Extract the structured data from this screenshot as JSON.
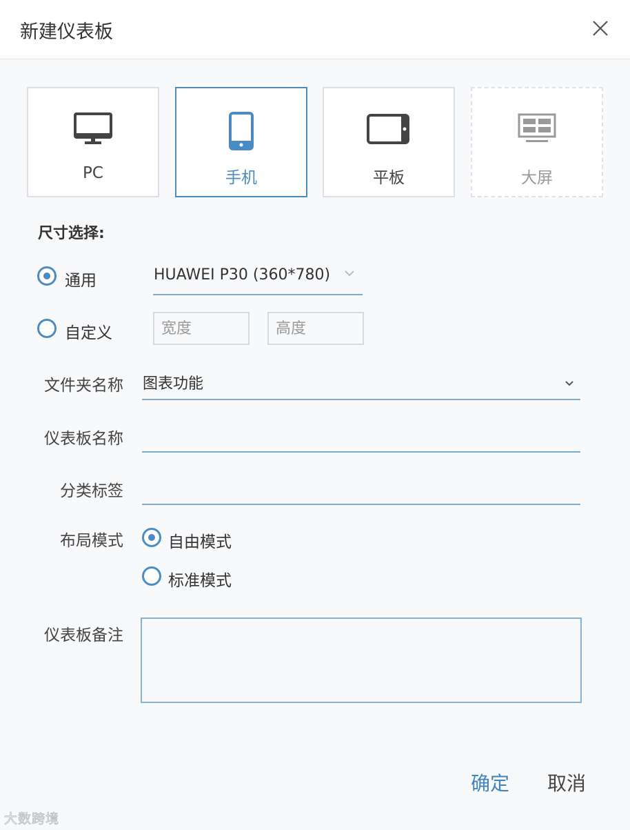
{
  "dialog": {
    "title": "新建仪表板"
  },
  "devices": [
    {
      "label": "PC",
      "icon": "monitor-icon"
    },
    {
      "label": "手机",
      "icon": "phone-icon"
    },
    {
      "label": "平板",
      "icon": "tablet-icon"
    },
    {
      "label": "大屏",
      "icon": "large-screen-icon"
    }
  ],
  "selected_device": "手机",
  "size": {
    "title": "尺寸选择:",
    "general_label": "通用",
    "preset_value": "HUAWEI P30 (360*780)",
    "custom_label": "自定义",
    "width_placeholder": "宽度",
    "height_placeholder": "高度"
  },
  "form": {
    "folder_label": "文件夹名称",
    "folder_value": "图表功能",
    "name_label": "仪表板名称",
    "name_value": "",
    "tag_label": "分类标签",
    "tag_value": "",
    "layout_label": "布局模式",
    "layout_free": "自由模式",
    "layout_standard": "标准模式",
    "remark_label": "仪表板备注",
    "remark_value": ""
  },
  "footer": {
    "ok": "确定",
    "cancel": "取消"
  },
  "watermark": "大数跨境",
  "colors": {
    "accent": "#4a8cc2",
    "border": "#dcdfe3",
    "background": "#f8f9fb"
  }
}
